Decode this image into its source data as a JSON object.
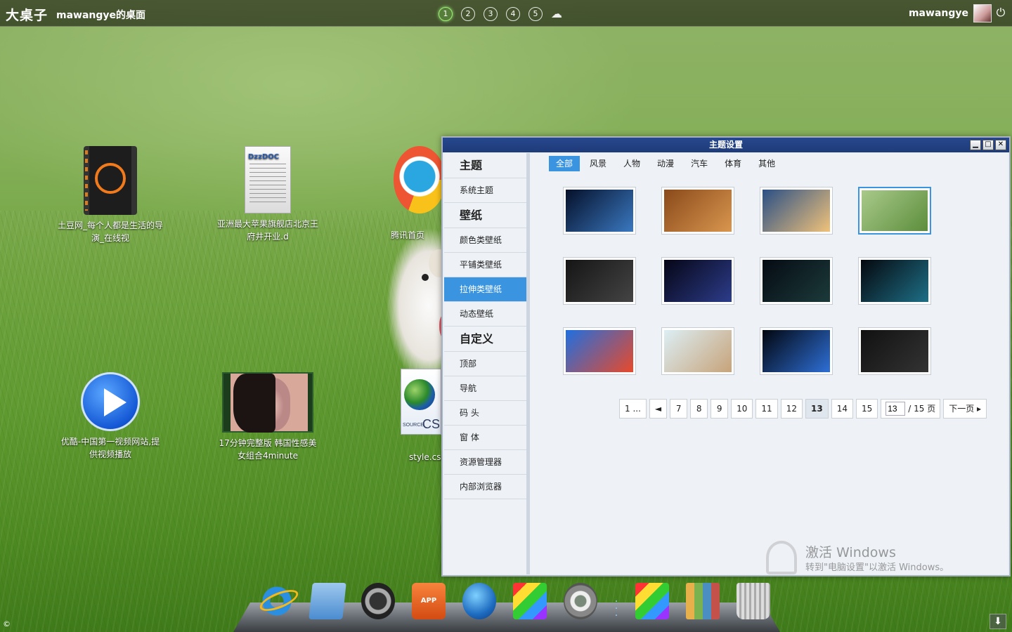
{
  "topbar": {
    "brand": "大桌子",
    "desk_title": "mawangye的桌面",
    "pages": [
      "1",
      "2",
      "3",
      "4",
      "5"
    ],
    "active_page": "1",
    "user_name": "mawangye"
  },
  "desktop_icons": [
    {
      "label": "土豆网_每个人都是生活的导演_在线视",
      "icon": "video-file-icon"
    },
    {
      "label": "亚洲最大苹果旗舰店北京王府井开业.d",
      "icon": "dzzdoc-file-icon"
    },
    {
      "label": "腾讯首页",
      "icon": "qq-icon"
    },
    {
      "label": "优酷-中国第一视频网站,提供视频播放",
      "icon": "play-icon"
    },
    {
      "label": "17分钟完整版 韩国性感美女组合4minute",
      "icon": "video-thumbnail"
    },
    {
      "label": "style.css",
      "icon": "css-file-icon"
    }
  ],
  "doc_icon_text": "DzzDOC",
  "css_icon_text": "CS",
  "css_icon_source": "SOURCE",
  "dialog": {
    "title": "主题设置",
    "sidebar": [
      {
        "label": "主题",
        "type": "header"
      },
      {
        "label": "系统主题",
        "type": "item"
      },
      {
        "label": "壁纸",
        "type": "header"
      },
      {
        "label": "颜色类壁纸",
        "type": "item"
      },
      {
        "label": "平铺类壁纸",
        "type": "item"
      },
      {
        "label": "拉伸类壁纸",
        "type": "item",
        "active": true
      },
      {
        "label": "动态壁纸",
        "type": "item"
      },
      {
        "label": "自定义",
        "type": "header"
      },
      {
        "label": "顶部",
        "type": "item"
      },
      {
        "label": "导航",
        "type": "item"
      },
      {
        "label": "码 头",
        "type": "item"
      },
      {
        "label": "窗 体",
        "type": "item"
      },
      {
        "label": "资源管理器",
        "type": "item"
      },
      {
        "label": "内部浏览器",
        "type": "item"
      }
    ],
    "tabs": [
      "全部",
      "风景",
      "人物",
      "动漫",
      "汽车",
      "体育",
      "其他"
    ],
    "active_tab": "全部",
    "wallpapers": [
      {
        "name": "space-planets",
        "colors": [
          "#05102a",
          "#3a78c0"
        ]
      },
      {
        "name": "brown-wood",
        "colors": [
          "#8a4a1a",
          "#d9964f"
        ]
      },
      {
        "name": "sunset-sky",
        "colors": [
          "#2a4f86",
          "#f0c27a"
        ]
      },
      {
        "name": "puppy-grass",
        "colors": [
          "#a9c98a",
          "#5c8e3c"
        ],
        "selected": true
      },
      {
        "name": "dark-carbon",
        "colors": [
          "#151515",
          "#444444"
        ]
      },
      {
        "name": "bokeh-lights",
        "colors": [
          "#060616",
          "#2c3c8a"
        ]
      },
      {
        "name": "nebula-planet",
        "colors": [
          "#050b12",
          "#1c3a3a"
        ]
      },
      {
        "name": "teal-nebula",
        "colors": [
          "#05080e",
          "#1e6f86"
        ]
      },
      {
        "name": "rainbow-stripes",
        "colors": [
          "#1f6fe0",
          "#e84a2a"
        ]
      },
      {
        "name": "room-shelf",
        "colors": [
          "#dceef4",
          "#c7a37a"
        ]
      },
      {
        "name": "blue-planet",
        "colors": [
          "#02060f",
          "#2e6fd6"
        ]
      },
      {
        "name": "dark-brushed",
        "colors": [
          "#111111",
          "#333333"
        ]
      }
    ],
    "pager": {
      "first": "1 ...",
      "prev": "◄",
      "pages": [
        "7",
        "8",
        "9",
        "10",
        "11",
        "12",
        "13",
        "14",
        "15"
      ],
      "current": "13",
      "input_value": "13",
      "total": "/ 15 页",
      "next": "下一页"
    }
  },
  "watermark": {
    "line1": "激活 Windows",
    "line2": "转到\"电脑设置\"以激活 Windows。"
  },
  "dock": [
    {
      "name": "ie-icon"
    },
    {
      "name": "folder-icon"
    },
    {
      "name": "dashboard-icon"
    },
    {
      "name": "app-store-icon",
      "label": "APP"
    },
    {
      "name": "www-icon"
    },
    {
      "name": "paint-icon"
    },
    {
      "name": "settings-gear-icon"
    },
    {
      "name": "paint-icon-2"
    },
    {
      "name": "books-icon"
    },
    {
      "name": "trash-icon"
    }
  ]
}
